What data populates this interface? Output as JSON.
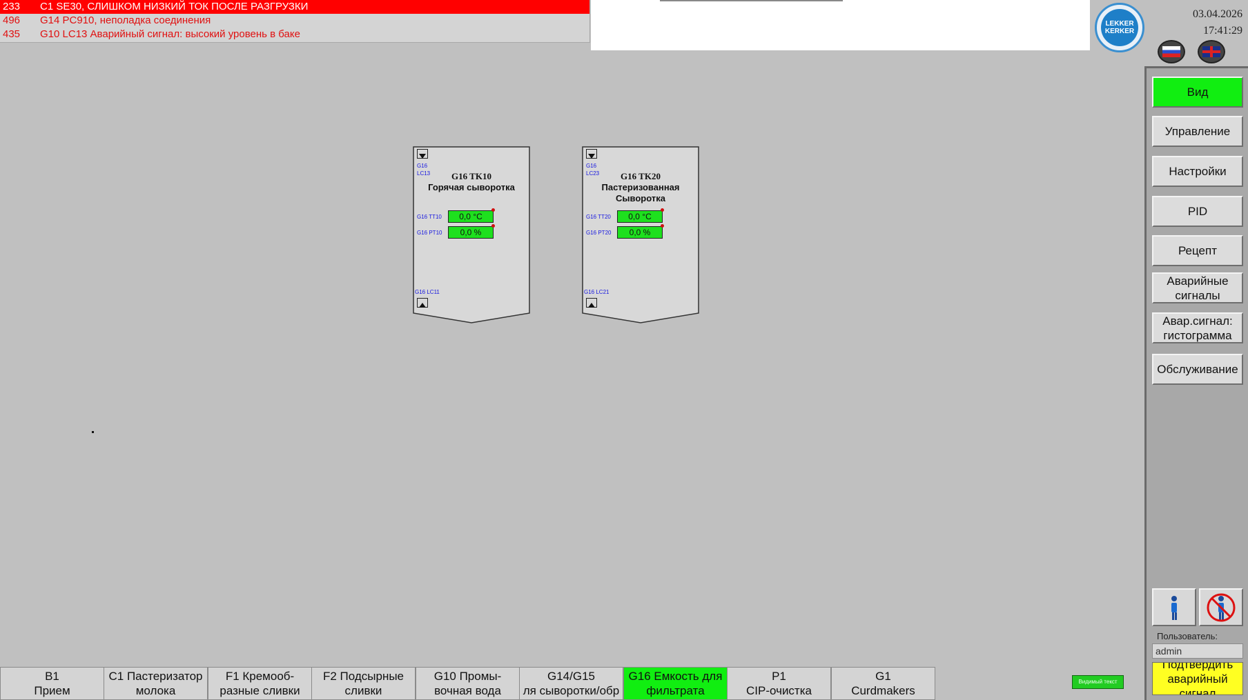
{
  "alarms": [
    {
      "id": "233",
      "text": "C1 SE30, СЛИШКОМ НИЗКИЙ ТОК ПОСЛЕ РАЗГРУЗКИ",
      "active": true
    },
    {
      "id": "496",
      "text": "G14 PC910, неполадка соединения",
      "active": false
    },
    {
      "id": "435",
      "text": "G10 LC13 Аварийный сигнал: высокий уровень в баке",
      "active": false
    }
  ],
  "header": {
    "logo_line1": "LEKKER",
    "logo_line2": "KERKER",
    "date": "03.04.2026",
    "time": "17:41:29"
  },
  "sidebar": {
    "buttons": [
      {
        "label": "Вид",
        "active": true
      },
      {
        "label": "Управление"
      },
      {
        "label": "Настройки"
      },
      {
        "label": "PID"
      },
      {
        "label": "Рецепт"
      },
      {
        "label": "Аварийные сигналы"
      },
      {
        "label": "Авар.сигнал: гистограмма"
      },
      {
        "label": "Обслуживание"
      }
    ],
    "user_label": "Пользователь:",
    "user_value": "admin",
    "confirm_label": "Подтвердить аварийный сигнал"
  },
  "tanks": [
    {
      "top_tag_1": "G16",
      "top_tag_2": "LC13",
      "title": "G16 TK10",
      "subtitle_1": "Горячая сыворотка",
      "subtitle_2": "",
      "temp_tag": "G16 TT10",
      "temp_value": "0,0 °C",
      "press_tag": "G16 PT10",
      "press_value": "0,0 %",
      "bottom_tag": "G16 LC11"
    },
    {
      "top_tag_1": "G16",
      "top_tag_2": "LC23",
      "title": "G16 TK20",
      "subtitle_1": "Пастеризованная",
      "subtitle_2": "Сыворотка",
      "temp_tag": "G16 TT20",
      "temp_value": "0,0 °C",
      "press_tag": "G16 PT20",
      "press_value": "0,0 %",
      "bottom_tag": "G16 LC21"
    }
  ],
  "tabs": [
    {
      "line1": "B1",
      "line2": "Прием"
    },
    {
      "line1": "C1 Пастеризатор",
      "line2": "молока"
    },
    {
      "line1": "F1 Кремооб-",
      "line2": "разные сливки"
    },
    {
      "line1": "F2 Подсырные",
      "line2": "сливки"
    },
    {
      "line1": "G10 Промы-",
      "line2": "вочная вода"
    },
    {
      "line1": "G14/G15",
      "line2": "ля сыворотки/обр"
    },
    {
      "line1": "G16 Емкость для",
      "line2": "фильтрата",
      "active": true
    },
    {
      "line1": "P1",
      "line2": "CIP-очистка"
    },
    {
      "line1": "G1",
      "line2": "Curdmakers"
    }
  ],
  "footer": {
    "visible_text_label": "Видимый текст"
  },
  "colors": {
    "active_green": "#11ee11",
    "alarm_red": "#ff0000",
    "confirm_yellow": "#ffff22"
  }
}
